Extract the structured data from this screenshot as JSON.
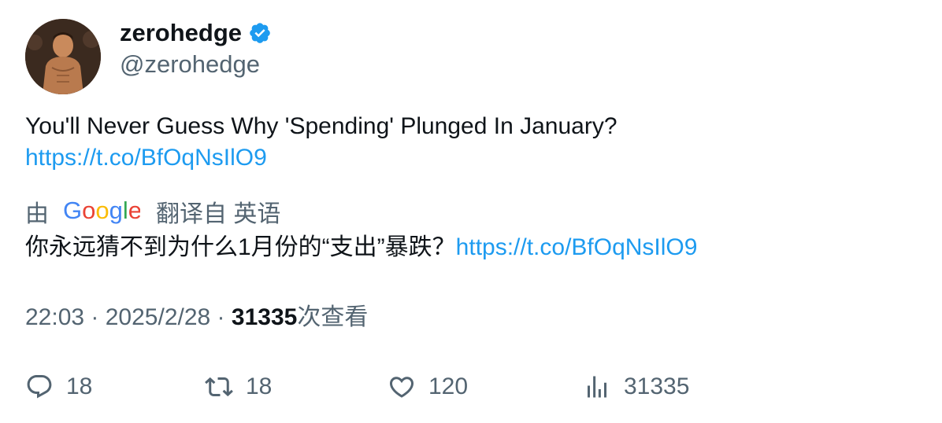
{
  "author": {
    "display_name": "zerohedge",
    "handle": "@zerohedge",
    "verified_icon": "verified-badge-icon",
    "verified_color": "#1d9bf0",
    "avatar": "profile-photo"
  },
  "tweet": {
    "text": "You'll Never Guess Why 'Spending' Plunged In January?",
    "link": "https://t.co/BfOqNsIlO9"
  },
  "translation": {
    "prefix": "由",
    "provider": "Google",
    "suffix": "翻译自 英语",
    "text": "你永远猜不到为什么1月份的“支出”暴跌？",
    "link": "https://t.co/BfOqNsIlO9"
  },
  "meta": {
    "time": "22:03",
    "separator": " · ",
    "date": "2025/2/28",
    "views_count": "31335",
    "views_label": "次查看"
  },
  "actions": {
    "replies": "18",
    "retweets": "18",
    "likes": "120",
    "views": "31335"
  },
  "colors": {
    "link": "#1d9bf0",
    "secondary_text": "#536471",
    "primary_text": "#0f1419"
  }
}
